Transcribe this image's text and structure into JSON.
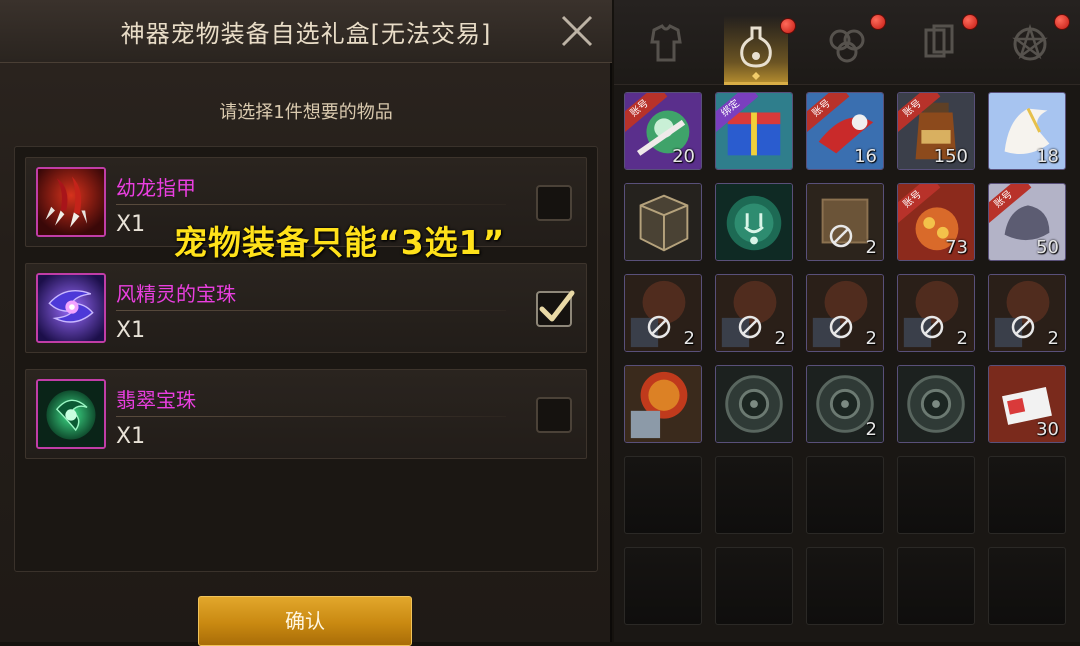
{
  "dialog": {
    "title": "神器宠物装备自选礼盒[无法交易]",
    "prompt": "请选择1件想要的物品",
    "confirm_label": "确认",
    "items": [
      {
        "name": "幼龙指甲",
        "qty": "X1",
        "checked": false,
        "icon": "dragon-claw-icon"
      },
      {
        "name": "风精灵的宝珠",
        "qty": "X1",
        "checked": true,
        "icon": "wind-spirit-orb-icon"
      },
      {
        "name": "翡翠宝珠",
        "qty": "X1",
        "checked": false,
        "icon": "jade-orb-icon"
      }
    ]
  },
  "overlay": {
    "caption": "宠物装备只能“3选1”"
  },
  "inventory": {
    "tabs": [
      {
        "icon": "armor-icon",
        "active": false,
        "badge": false
      },
      {
        "icon": "potion-icon",
        "active": true,
        "badge": true
      },
      {
        "icon": "material-icon",
        "active": false,
        "badge": true
      },
      {
        "icon": "cards-icon",
        "active": false,
        "badge": true
      },
      {
        "icon": "pentagram-icon",
        "active": false,
        "badge": true
      }
    ],
    "tags": {
      "account": "账号",
      "bound": "绑定"
    },
    "rows": [
      [
        {
          "tag": "account",
          "count": "20",
          "art": "ball"
        },
        {
          "tag": "bound",
          "count": "",
          "art": "box"
        },
        {
          "tag": "account",
          "count": "16",
          "art": "horn"
        },
        {
          "tag": "account",
          "count": "150",
          "art": "bottle"
        },
        {
          "tag": "",
          "count": "18",
          "art": "glove"
        }
      ],
      [
        {
          "tag": "",
          "count": "",
          "art": "cube"
        },
        {
          "tag": "",
          "count": "",
          "art": "green-orb"
        },
        {
          "tag": "",
          "count": "2",
          "art": "scroll",
          "ban": true
        },
        {
          "tag": "account",
          "count": "73",
          "art": "sack"
        },
        {
          "tag": "account",
          "count": "50",
          "art": "stone"
        }
      ],
      [
        {
          "tag": "",
          "count": "2",
          "art": "bag",
          "ban": true
        },
        {
          "tag": "",
          "count": "2",
          "art": "bag",
          "ban": true
        },
        {
          "tag": "",
          "count": "2",
          "art": "bag",
          "ban": true
        },
        {
          "tag": "",
          "count": "2",
          "art": "bag",
          "ban": true
        },
        {
          "tag": "",
          "count": "2",
          "art": "bag",
          "ban": true
        }
      ],
      [
        {
          "tag": "",
          "count": "",
          "art": "red-pouch"
        },
        {
          "tag": "",
          "count": "",
          "art": "disc"
        },
        {
          "tag": "",
          "count": "2",
          "art": "disc"
        },
        {
          "tag": "",
          "count": "",
          "art": "disc"
        },
        {
          "tag": "",
          "count": "30",
          "art": "ticket"
        }
      ],
      [
        {
          "tag": "",
          "count": "",
          "art": "empty"
        },
        {
          "tag": "",
          "count": "",
          "art": "empty"
        },
        {
          "tag": "",
          "count": "",
          "art": "empty"
        },
        {
          "tag": "",
          "count": "",
          "art": "empty"
        },
        {
          "tag": "",
          "count": "",
          "art": "empty"
        }
      ],
      [
        {
          "tag": "",
          "count": "",
          "art": "empty"
        },
        {
          "tag": "",
          "count": "",
          "art": "empty"
        },
        {
          "tag": "",
          "count": "",
          "art": "empty"
        },
        {
          "tag": "",
          "count": "",
          "art": "empty"
        },
        {
          "tag": "",
          "count": "",
          "art": "empty"
        }
      ]
    ]
  },
  "colors": {
    "item_name": "#ea3fe0",
    "caption": "#ffe11a",
    "confirm": "#c98911",
    "badge": "#c31a12"
  }
}
